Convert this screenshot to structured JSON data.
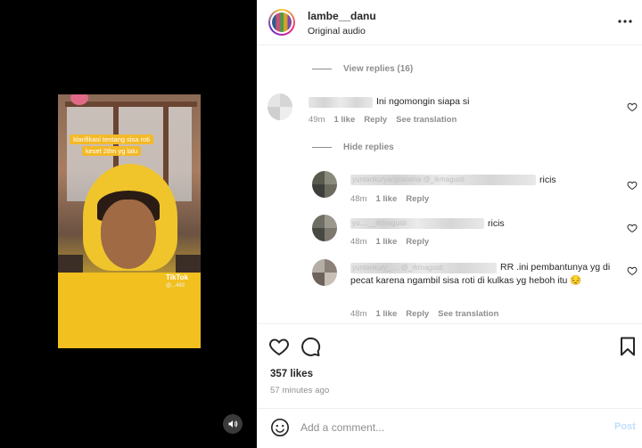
{
  "post": {
    "username": "lambe__danu",
    "audio": "Original audio",
    "likes": "357 likes",
    "time": "57 minutes ago"
  },
  "video": {
    "caption": "klarifikasi tentang sisa roti keset 2thn yg lalu",
    "watermark": "TikTok",
    "watermark_user": "@...483"
  },
  "comments": {
    "view_replies": "View replies (16)",
    "hide_replies": "Hide replies",
    "items": [
      {
        "text": "Ini ngomongin siapa si",
        "time": "49m",
        "likes": "1 like",
        "reply": "Reply",
        "translate": "See translation"
      },
      {
        "name_blur": "yuntankuryanpratama @_ikmagusti",
        "text": "ricis",
        "time": "48m",
        "likes": "1 like",
        "reply": "Reply"
      },
      {
        "name_blur": "yu....__rkmagusti",
        "text": "ricis",
        "time": "48m",
        "likes": "1 like",
        "reply": "Reply"
      },
      {
        "name_blur": "yuntankury_.... @_rkmagusti",
        "text": "RR .ini pembantunya yg di pecat karena ngambil sisa roti di kulkas yg heboh itu 😔",
        "time": "48m",
        "likes": "1 like",
        "reply": "Reply",
        "translate": "See translation"
      }
    ]
  },
  "composer": {
    "placeholder": "Add a comment...",
    "post_label": "Post"
  },
  "icons": [
    "more-icon",
    "heart-icon",
    "comment-icon",
    "save-icon",
    "emoji-icon",
    "sound-icon"
  ],
  "colors": {
    "link_blue": "#c0dffd",
    "muted": "#8e8e8e",
    "text": "#262626",
    "caption_bg": "#f3b929"
  }
}
